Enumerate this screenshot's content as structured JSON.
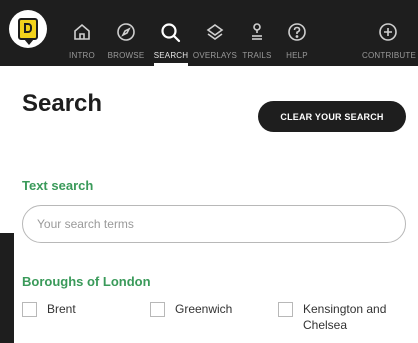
{
  "nav": {
    "items": [
      {
        "label": "INTRO",
        "icon": "home-icon"
      },
      {
        "label": "BROWSE",
        "icon": "compass-icon"
      },
      {
        "label": "SEARCH",
        "icon": "search-icon"
      },
      {
        "label": "OVERLAYS",
        "icon": "layers-icon"
      },
      {
        "label": "TRAILS",
        "icon": "trail-icon"
      },
      {
        "label": "HELP",
        "icon": "help-icon"
      },
      {
        "label": "CONTRIBUTE",
        "icon": "plus-circle-icon"
      }
    ],
    "active": "SEARCH"
  },
  "panel": {
    "title": "Search",
    "clear_button": "CLEAR YOUR SEARCH",
    "text_search": {
      "heading": "Text search",
      "placeholder": "Your search terms",
      "value": ""
    },
    "boroughs": {
      "heading": "Boroughs of London",
      "options": [
        {
          "label": "Brent",
          "checked": false
        },
        {
          "label": "Greenwich",
          "checked": false
        },
        {
          "label": "Kensington and Chelsea",
          "checked": false
        }
      ]
    }
  },
  "colors": {
    "nav_background": "#1e1e1e",
    "heading_green": "#3a9a5a",
    "logo_yellow": "#f2d21b"
  }
}
